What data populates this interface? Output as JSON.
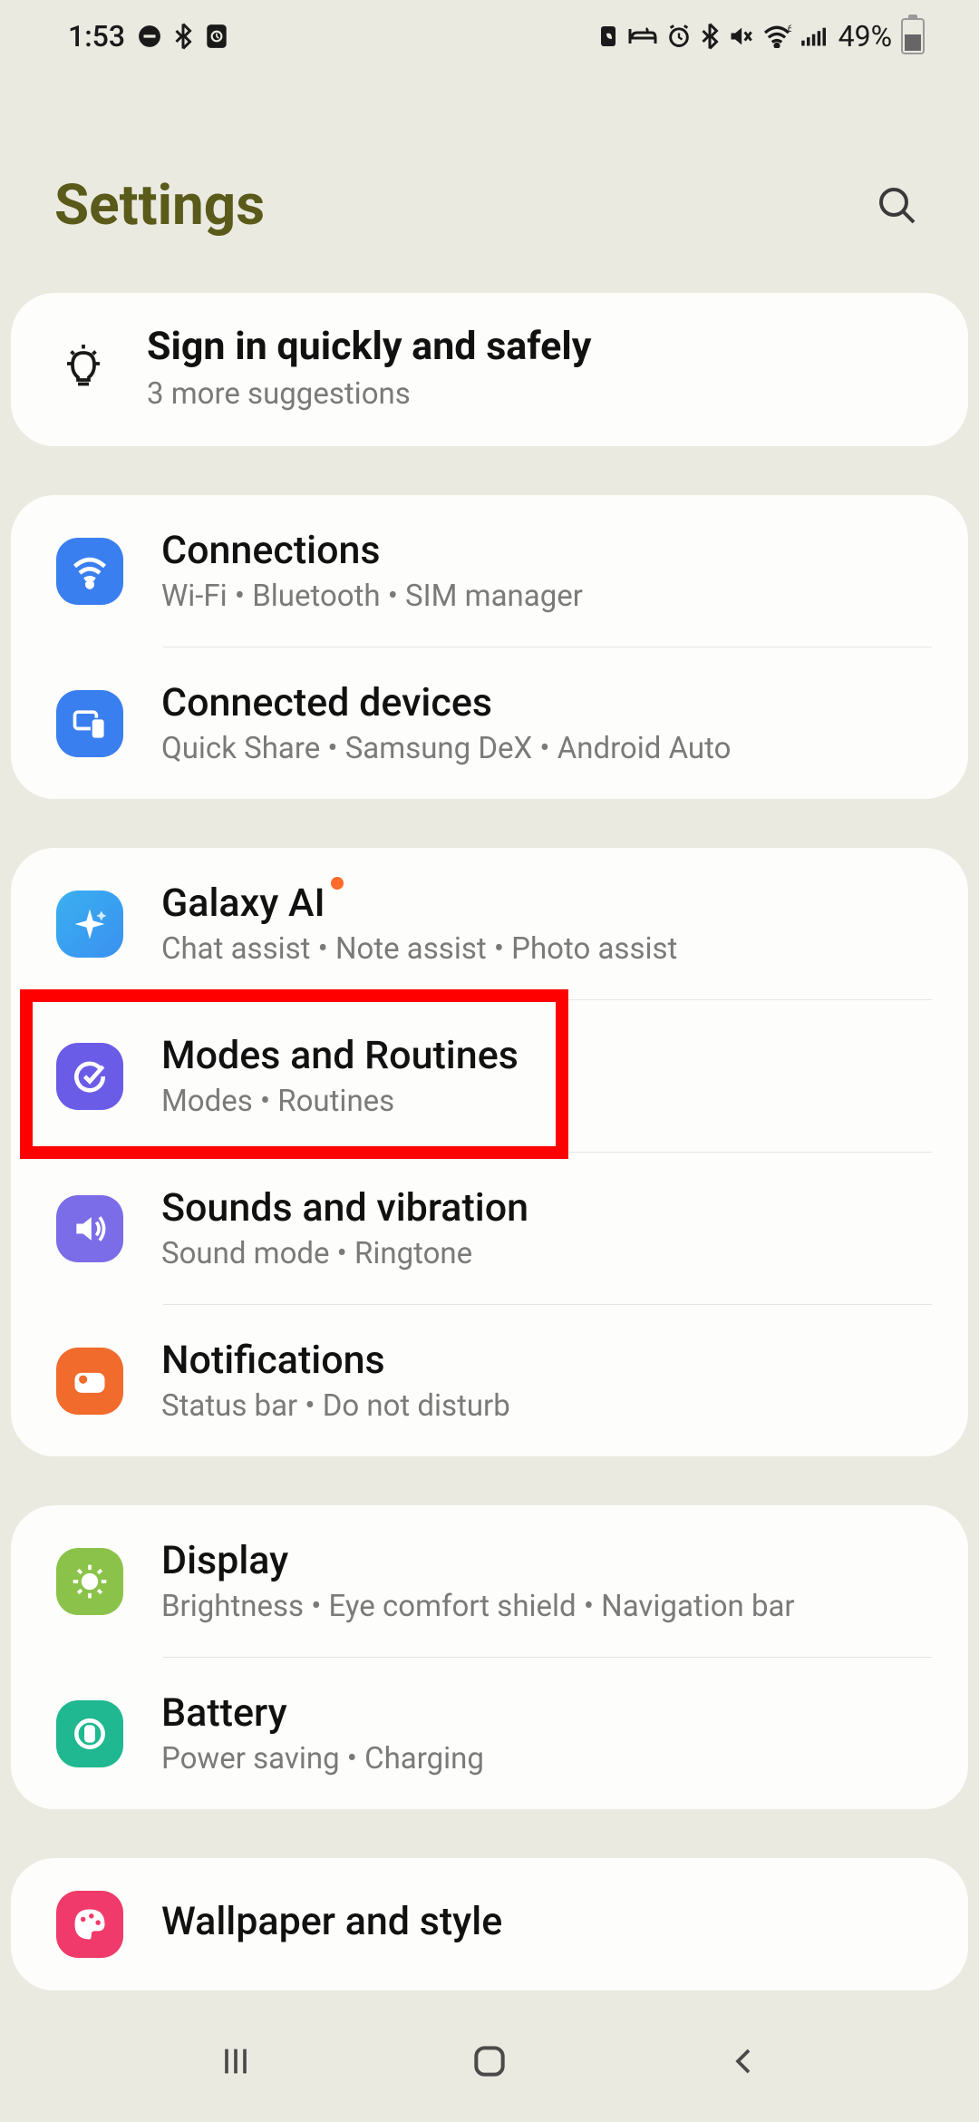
{
  "status": {
    "time": "1:53",
    "battery_pct": "49%"
  },
  "header": {
    "title": "Settings"
  },
  "suggestion": {
    "title": "Sign in quickly and safely",
    "sub": "3 more suggestions"
  },
  "groups": [
    {
      "items": [
        {
          "id": "connections",
          "title": "Connections",
          "sub": "Wi-Fi  •  Bluetooth  •  SIM manager",
          "icon": "wifi",
          "color": "ic-blue"
        },
        {
          "id": "connected-devices",
          "title": "Connected devices",
          "sub": "Quick Share  •  Samsung DeX  •  Android Auto",
          "icon": "devices",
          "color": "ic-blue2"
        }
      ]
    },
    {
      "items": [
        {
          "id": "galaxy-ai",
          "title": "Galaxy AI",
          "sub": "Chat assist  •  Note assist  •  Photo assist",
          "icon": "sparkle",
          "color": "ic-cyan",
          "badge": true
        },
        {
          "id": "modes-routines",
          "title": "Modes and Routines",
          "sub": "Modes  •  Routines",
          "icon": "check-circle",
          "color": "ic-purple",
          "highlighted": true
        },
        {
          "id": "sounds-vibration",
          "title": "Sounds and vibration",
          "sub": "Sound mode  •  Ringtone",
          "icon": "volume",
          "color": "ic-purple2"
        },
        {
          "id": "notifications",
          "title": "Notifications",
          "sub": "Status bar  •  Do not disturb",
          "icon": "bell",
          "color": "ic-orange"
        }
      ]
    },
    {
      "items": [
        {
          "id": "display",
          "title": "Display",
          "sub": "Brightness  •  Eye comfort shield  •  Navigation bar",
          "icon": "sun",
          "color": "ic-green"
        },
        {
          "id": "battery",
          "title": "Battery",
          "sub": "Power saving  •  Charging",
          "icon": "battery",
          "color": "ic-teal"
        }
      ]
    },
    {
      "items": [
        {
          "id": "wallpaper-style",
          "title": "Wallpaper and style",
          "sub": "",
          "icon": "palette",
          "color": "ic-pink"
        }
      ]
    }
  ]
}
